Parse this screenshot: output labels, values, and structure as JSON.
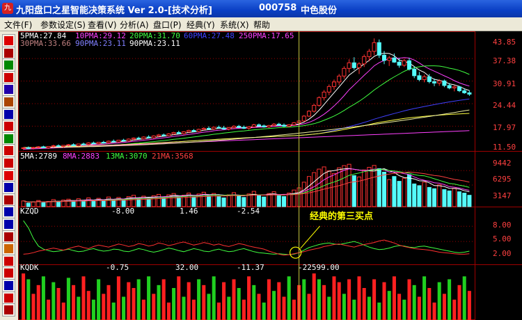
{
  "window": {
    "app_icon": "九",
    "title": "九阳盘口之星智能决策系统 Ver 2.0-[技术分析]",
    "stock_code": "000758",
    "stock_name": "中色股份"
  },
  "menu": [
    "文件(F)",
    "参数设定(S)",
    "查看(V)",
    "分析(A)",
    "盘口(P)",
    "经典(Y)",
    "系统(X)",
    "帮助"
  ],
  "toolbar_icons": [
    "line-chart-icon",
    "candle-icon",
    "trend-icon",
    "bars-icon",
    "wave-icon",
    "indicator-icon",
    "table-icon",
    "w-icon",
    "gear-icon",
    "plus-icon",
    "cross-icon",
    "f10-icon",
    "book-icon",
    "scroll-icon",
    "people-icon",
    "grid-icon",
    "list-icon",
    "pen-icon",
    "arrow-icon",
    "fbk-icon",
    "fbk-icon-2",
    "save-icon",
    "chart-icon"
  ],
  "colors": {
    "up": "#ff3232",
    "down": "#54fcfc",
    "grid": "#a00000",
    "crosshair": "#c8c840",
    "axis": "#ff4040"
  },
  "price_panel": {
    "legend": [
      {
        "text": "5PMA:27.84",
        "color": "#ffffff"
      },
      {
        "text": "10PMA:29.12",
        "color": "#ff40ff"
      },
      {
        "text": "20PMA:31.70",
        "color": "#40ff40"
      },
      {
        "text": "60PMA:27.48",
        "color": "#4040ff"
      },
      {
        "text": "250PMA:17.65",
        "color": "#ff40ff"
      },
      {
        "text": "30PMA:33.66",
        "color": "#c08080"
      },
      {
        "text": "90PMA:23.11",
        "color": "#8080ff"
      },
      {
        "text": "90PMA:23.11",
        "color": "#ffffff"
      }
    ],
    "y_axis": [
      "43.85",
      "37.38",
      "30.91",
      "24.44",
      "17.97",
      "11.50"
    ],
    "ylim": [
      11.5,
      43.85
    ]
  },
  "volume_panel": {
    "legend": [
      {
        "text": "5MA:2789",
        "color": "#ffffff"
      },
      {
        "text": "8MA:2883",
        "color": "#ff40ff"
      },
      {
        "text": "13MA:3070",
        "color": "#40ff40"
      },
      {
        "text": "21MA:3568",
        "color": "#ff4040"
      }
    ],
    "y_axis": [
      "9442",
      "6295",
      "3147"
    ],
    "ylim": [
      0,
      11000
    ]
  },
  "kzqd_panel": {
    "name": "KZQD",
    "values": [
      "-8.00",
      "1.46",
      "-2.54"
    ],
    "y_axis": [
      "8.00",
      "5.00",
      "2.00"
    ],
    "ylim": [
      0,
      10
    ]
  },
  "kqdk_panel": {
    "name": "KQDK",
    "values": [
      "-0.75",
      "32.00",
      "-11.37",
      "-22599.00"
    ]
  },
  "annotation": {
    "text": "经典的第三买点"
  },
  "chart_data": {
    "type": "candlestick",
    "title": "",
    "note": "daily K-line of 000758 with MA overlays, volume, KZQD and KQDK indicators",
    "ylim": [
      11.5,
      43.85
    ],
    "candles": [
      [
        12.2,
        12.6,
        11.8,
        12.4
      ],
      [
        12.4,
        12.8,
        12.0,
        12.3
      ],
      [
        12.3,
        12.7,
        11.9,
        12.5
      ],
      [
        12.5,
        12.9,
        12.2,
        12.7
      ],
      [
        12.7,
        13.0,
        12.3,
        12.4
      ],
      [
        12.4,
        12.9,
        12.1,
        12.8
      ],
      [
        12.8,
        13.3,
        12.5,
        13.0
      ],
      [
        13.0,
        13.4,
        12.6,
        12.8
      ],
      [
        12.8,
        13.2,
        12.4,
        13.1
      ],
      [
        13.1,
        13.5,
        12.8,
        13.3
      ],
      [
        13.3,
        13.7,
        12.9,
        13.0
      ],
      [
        13.0,
        13.6,
        12.8,
        13.5
      ],
      [
        13.5,
        13.9,
        13.1,
        13.4
      ],
      [
        13.4,
        14.0,
        13.0,
        13.8
      ],
      [
        13.8,
        14.2,
        13.4,
        13.6
      ],
      [
        13.6,
        14.1,
        13.3,
        14.0
      ],
      [
        14.0,
        14.4,
        13.6,
        13.9
      ],
      [
        13.9,
        14.5,
        13.6,
        14.3
      ],
      [
        14.3,
        14.8,
        14.0,
        14.1
      ],
      [
        14.1,
        14.7,
        13.9,
        14.6
      ],
      [
        14.6,
        15.0,
        14.2,
        14.4
      ],
      [
        14.4,
        15.1,
        14.2,
        14.9
      ],
      [
        14.9,
        15.4,
        14.5,
        15.2
      ],
      [
        15.2,
        15.6,
        14.8,
        15.0
      ],
      [
        15.0,
        15.7,
        14.8,
        15.5
      ],
      [
        15.5,
        16.0,
        15.1,
        15.3
      ],
      [
        15.3,
        16.0,
        15.0,
        15.8
      ],
      [
        15.8,
        16.4,
        15.5,
        16.1
      ],
      [
        16.1,
        16.5,
        15.7,
        15.9
      ],
      [
        15.9,
        16.6,
        15.7,
        16.4
      ],
      [
        16.4,
        17.0,
        16.1,
        16.8
      ],
      [
        16.8,
        17.3,
        16.3,
        16.5
      ],
      [
        16.5,
        17.2,
        16.2,
        17.0
      ],
      [
        17.0,
        17.6,
        16.7,
        17.4
      ],
      [
        17.4,
        17.8,
        16.9,
        17.1
      ],
      [
        17.1,
        17.9,
        16.9,
        17.7
      ],
      [
        17.7,
        18.3,
        17.4,
        18.0
      ],
      [
        18.0,
        18.6,
        17.5,
        17.8
      ],
      [
        17.8,
        18.5,
        17.5,
        18.3
      ],
      [
        18.3,
        18.8,
        17.9,
        18.1
      ],
      [
        18.1,
        18.7,
        17.6,
        17.8
      ],
      [
        17.8,
        18.4,
        17.4,
        18.2
      ],
      [
        18.2,
        18.9,
        17.9,
        18.6
      ],
      [
        18.6,
        19.0,
        18.1,
        18.3
      ],
      [
        18.3,
        18.8,
        17.8,
        18.0
      ],
      [
        18.0,
        18.6,
        17.6,
        18.4
      ],
      [
        18.4,
        19.3,
        18.2,
        19.0
      ],
      [
        19.0,
        19.4,
        18.5,
        18.7
      ],
      [
        18.7,
        19.1,
        18.2,
        18.4
      ],
      [
        18.4,
        19.0,
        18.1,
        18.8
      ],
      [
        18.8,
        19.5,
        18.5,
        19.2
      ],
      [
        19.2,
        19.6,
        18.7,
        18.9
      ],
      [
        18.9,
        19.4,
        18.4,
        18.6
      ],
      [
        18.6,
        19.2,
        18.3,
        19.0
      ],
      [
        19.0,
        19.8,
        18.8,
        19.6
      ],
      [
        19.6,
        20.4,
        19.3,
        20.1
      ],
      [
        20.1,
        21.8,
        19.9,
        21.5
      ],
      [
        21.5,
        23.2,
        21.2,
        22.9
      ],
      [
        22.9,
        25.0,
        22.5,
        24.6
      ],
      [
        24.6,
        27.2,
        24.2,
        26.8
      ],
      [
        26.8,
        29.0,
        26.0,
        28.4
      ],
      [
        28.4,
        30.6,
        27.5,
        30.0
      ],
      [
        30.0,
        32.0,
        29.1,
        31.3
      ],
      [
        31.3,
        33.6,
        30.4,
        33.0
      ],
      [
        33.0,
        35.8,
        32.2,
        35.2
      ],
      [
        35.2,
        37.8,
        34.0,
        36.8
      ],
      [
        36.8,
        38.4,
        34.8,
        35.4
      ],
      [
        35.4,
        37.0,
        33.6,
        36.5
      ],
      [
        36.5,
        39.2,
        35.6,
        38.6
      ],
      [
        38.6,
        40.8,
        37.2,
        40.1
      ],
      [
        40.1,
        43.8,
        39.0,
        42.6
      ],
      [
        42.6,
        43.5,
        38.2,
        39.0
      ],
      [
        39.0,
        40.2,
        36.4,
        37.5
      ],
      [
        37.5,
        38.8,
        35.9,
        38.2
      ],
      [
        38.2,
        39.5,
        36.8,
        37.0
      ],
      [
        37.0,
        38.1,
        35.4,
        36.1
      ],
      [
        36.1,
        38.0,
        35.6,
        37.4
      ],
      [
        37.4,
        38.2,
        34.6,
        35.0
      ],
      [
        35.0,
        35.8,
        32.4,
        33.1
      ],
      [
        33.1,
        34.2,
        31.5,
        32.0
      ],
      [
        32.0,
        33.4,
        31.2,
        32.8
      ],
      [
        32.8,
        33.6,
        30.9,
        31.4
      ],
      [
        31.4,
        32.3,
        30.1,
        31.0
      ],
      [
        31.0,
        32.1,
        30.2,
        31.6
      ],
      [
        31.6,
        32.0,
        29.8,
        30.3
      ],
      [
        30.3,
        31.0,
        29.2,
        29.6
      ],
      [
        29.6,
        30.4,
        28.6,
        29.9
      ],
      [
        29.9,
        30.2,
        28.4,
        28.8
      ],
      [
        28.8,
        29.5,
        27.9,
        28.2
      ],
      [
        28.2,
        28.9,
        27.3,
        27.8
      ]
    ],
    "volume": [
      1300,
      800,
      1100,
      1400,
      900,
      1200,
      1600,
      1000,
      1500,
      1700,
      1100,
      1800,
      1300,
      2000,
      1400,
      1900,
      1300,
      2200,
      1600,
      2100,
      1500,
      2300,
      2600,
      1800,
      2400,
      1700,
      2500,
      2800,
      2000,
      2700,
      3000,
      2100,
      2600,
      3100,
      2200,
      2900,
      3300,
      2400,
      3000,
      2300,
      2000,
      2700,
      3200,
      2400,
      2100,
      2900,
      3500,
      2600,
      2200,
      3000,
      3400,
      2500,
      2300,
      3100,
      3800,
      4300,
      5600,
      6900,
      7800,
      8600,
      9100,
      8200,
      7600,
      8900,
      9400,
      9700,
      7100,
      6800,
      8400,
      9000,
      9440,
      8700,
      7900,
      6200,
      6900,
      5800,
      6500,
      7300,
      5200,
      4800,
      5600,
      4400,
      4100,
      5000,
      3900,
      3600,
      4200,
      3400,
      3100,
      2600
    ],
    "kzqd": [
      8.6,
      7.2,
      5.1,
      3.6,
      3.0,
      2.7,
      2.5,
      2.6,
      2.8,
      3.0,
      2.7,
      2.5,
      2.6,
      2.9,
      3.1,
      2.8,
      2.6,
      2.7,
      3.0,
      2.9,
      2.6,
      2.5,
      2.8,
      3.1,
      2.9,
      2.6,
      2.4,
      2.6,
      2.9,
      3.2,
      3.0,
      2.7,
      2.5,
      2.8,
      3.1,
      2.9,
      2.6,
      2.5,
      2.8,
      3.0,
      2.7,
      2.5,
      2.6,
      2.9,
      3.1,
      2.8,
      2.5,
      2.3,
      2.2,
      2.1,
      2.0,
      2.1,
      2.0,
      1.9,
      2.0,
      2.3,
      2.8,
      3.3,
      3.6,
      3.9,
      4.1,
      4.2,
      4.0,
      3.9,
      4.1,
      4.3,
      4.5,
      4.2,
      3.8,
      3.4,
      3.1,
      2.9,
      3.0,
      3.2,
      3.5,
      3.7,
      3.6,
      3.4,
      3.3,
      3.5,
      3.6,
      3.4,
      3.2,
      3.0,
      2.8,
      2.6,
      2.4,
      2.3,
      2.4,
      2.6
    ],
    "kzqd2": [
      2.0,
      2.1,
      2.3,
      2.6,
      2.8,
      3.0,
      3.2,
      3.0,
      2.8,
      3.1,
      3.4,
      3.6,
      3.3,
      3.1,
      3.5,
      3.8,
      3.6,
      3.4,
      3.7,
      4.0,
      3.8,
      3.5,
      3.7,
      4.1,
      3.9,
      3.6,
      3.8,
      4.2,
      4.0,
      3.7,
      3.9,
      4.2,
      4.4,
      4.1,
      3.8,
      4.0,
      4.3,
      4.1,
      3.8,
      4.0,
      3.7,
      3.5,
      3.8,
      4.1,
      3.9,
      3.6,
      3.4,
      3.2,
      3.0,
      2.6,
      2.3,
      2.0,
      1.8,
      1.9,
      2.1,
      2.3,
      2.5,
      2.8,
      3.0,
      3.2,
      3.5,
      3.7,
      3.9,
      4.0,
      3.8,
      3.6,
      3.4,
      3.7,
      3.9,
      4.1,
      4.3,
      4.6,
      4.8,
      4.5,
      4.2,
      3.8,
      3.5,
      3.3,
      3.1,
      3.0,
      2.9,
      2.8,
      2.6,
      2.4,
      2.3,
      2.2,
      2.1,
      2.0,
      2.0,
      2.1
    ],
    "kqdk": [
      160,
      140,
      90,
      120,
      150,
      70,
      130,
      110,
      60,
      145,
      120,
      80,
      150,
      100,
      70,
      140,
      90,
      120,
      60,
      150,
      80,
      130,
      110,
      140,
      70,
      150,
      90,
      120,
      140,
      60,
      110,
      150,
      80,
      130,
      70,
      140,
      120,
      90,
      150,
      60,
      130,
      80,
      140,
      110,
      70,
      150,
      120,
      90,
      60,
      140,
      100,
      130,
      80,
      150,
      70,
      120,
      140,
      90,
      160,
      140,
      120,
      80,
      150,
      130,
      90,
      140,
      70,
      150,
      110,
      80,
      140,
      60,
      130,
      100,
      150,
      90,
      70,
      140,
      120,
      80,
      150,
      110,
      60,
      130,
      90,
      140,
      70,
      120,
      150,
      100
    ],
    "kqdk_up": [
      1,
      0,
      1,
      1,
      0,
      1,
      0,
      1,
      1,
      0,
      1,
      0,
      1,
      1,
      0,
      0,
      1,
      1,
      0,
      1,
      0,
      1,
      1,
      0,
      1,
      0,
      1,
      0,
      1,
      1,
      0,
      1,
      0,
      1,
      1,
      0,
      1,
      0,
      0,
      1,
      1,
      0,
      1,
      0,
      1,
      1,
      0,
      1,
      0,
      1,
      0,
      1,
      1,
      0,
      1,
      1,
      0,
      1,
      1,
      0,
      1,
      0,
      1,
      1,
      0,
      1,
      0,
      1,
      1,
      0,
      1,
      0,
      1,
      0,
      1,
      1,
      0,
      1,
      0,
      1,
      0,
      1,
      1,
      0,
      1,
      0,
      1,
      1,
      0,
      1
    ],
    "crosshair_index": 55,
    "ma_periods": [
      5,
      10,
      20,
      60,
      250
    ]
  }
}
